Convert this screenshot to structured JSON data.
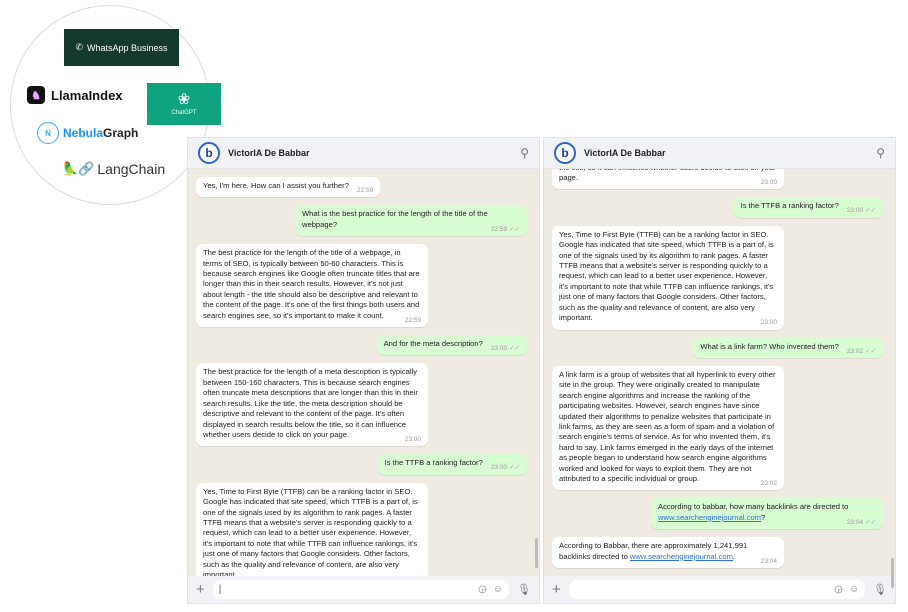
{
  "logos": {
    "whatsapp_business": "WhatsApp Business",
    "llamaindex": "LlamaIndex",
    "chatgpt": "ChatGPT",
    "nebula_a": "Nebula",
    "nebula_b": "Graph",
    "langchain": "LangChain"
  },
  "contact_name": "VictorIA De Babbar",
  "left_chat": [
    {
      "dir": "in",
      "text": "Yes, I'm here. How can I assist you further?",
      "time": "22:59"
    },
    {
      "dir": "out",
      "text": "What is the best practice for the length of the title of the webpage?",
      "time": "22:59"
    },
    {
      "dir": "in",
      "text": "The best practice for the length of the title of a webpage, in terms of SEO, is typically between 50-60 characters. This is because search engines like Google often truncate titles that are longer than this in their search results. However, it's not just about length - the title should also be descriptive and relevant to the content of the page. It's one of the first things both users and search engines see, so it's important to make it count.",
      "time": "22:59"
    },
    {
      "dir": "out",
      "text": "And for the meta description?",
      "time": "23:00"
    },
    {
      "dir": "in",
      "text": "The best practice for the length of a meta description is typically between 150-160 characters. This is because search engines often truncate meta descriptions that are longer than this in their search results. Like the title, the meta description should be descriptive and relevant to the content of the page. It's often displayed in search results below the title, so it can influence whether users decide to click on your page.",
      "time": "23:00"
    },
    {
      "dir": "out",
      "text": "Is the TTFB a ranking factor?",
      "time": "23:00"
    },
    {
      "dir": "in",
      "text": "Yes, Time to First Byte (TTFB) can be a ranking factor in SEO. Google has indicated that site speed, which TTFB is a part of, is one of the signals used by its algorithm to rank pages. A faster TTFB means that a website's server is responding quickly to a request, which can lead to a better user experience. However, it's important to note that while TTFB can influence rankings, it's just one of many factors that Google considers. Other factors, such as the quality and relevance of content, are also very important.",
      "time": "23:00"
    }
  ],
  "right_chat": [
    {
      "dir": "in",
      "text": "content of the page. It's often displayed in search results below the title, so it can influence whether users decide to click on your page.",
      "time": "23:00"
    },
    {
      "dir": "out",
      "text": "Is the TTFB a ranking factor?",
      "time": "23:00"
    },
    {
      "dir": "in",
      "text": "Yes, Time to First Byte (TTFB) can be a ranking factor in SEO. Google has indicated that site speed, which TTFB is a part of, is one of the signals used by its algorithm to rank pages. A faster TTFB means that a website's server is responding quickly to a request, which can lead to a better user experience. However, it's important to note that while TTFB can influence rankings, it's just one of many factors that Google considers. Other factors, such as the quality and relevance of content, are also very important.",
      "time": "23:00"
    },
    {
      "dir": "out",
      "text": "What is a link farm? Who invented them?",
      "time": "23:02"
    },
    {
      "dir": "in",
      "text": "A link farm is a group of websites that all hyperlink to every other site in the group. They were originally created to manipulate search engine algorithms and increase the ranking of the participating websites. However, search engines have since updated their algorithms to penalize websites that participate in link farms, as they are seen as a form of spam and a violation of search engine's terms of service.  As for who invented them, it's hard to say. Link farms emerged in the early days of the internet as people began to understand how search engine algorithms worked and looked for ways to exploit them. They are not attributed to a specific individual or group.",
      "time": "23:02"
    },
    {
      "dir": "out",
      "text": "According to babbar, how many backlinks are directed to ",
      "link": "www.searchenginejournal.com",
      "after": "?",
      "time": "23:04"
    },
    {
      "dir": "in",
      "text": "According to Babbar, there are approximately 1,241,991 backlinks directed to ",
      "link": "www.searchenginejournal.com",
      "after": ".",
      "time": "23:04"
    }
  ],
  "input_placeholder": "",
  "icons": {
    "search": "search-icon",
    "attach": "plus-icon",
    "sticker": "sticker-icon",
    "emoji": "emoji-icon",
    "mic": "microphone-icon",
    "read": "double-check-icon"
  },
  "colors": {
    "outgoing_bubble": "#d9fdd3",
    "incoming_bubble": "#ffffff",
    "chat_bg": "#efeae2",
    "whatsapp_business": "#133a2a",
    "chatgpt": "#10a37f"
  }
}
